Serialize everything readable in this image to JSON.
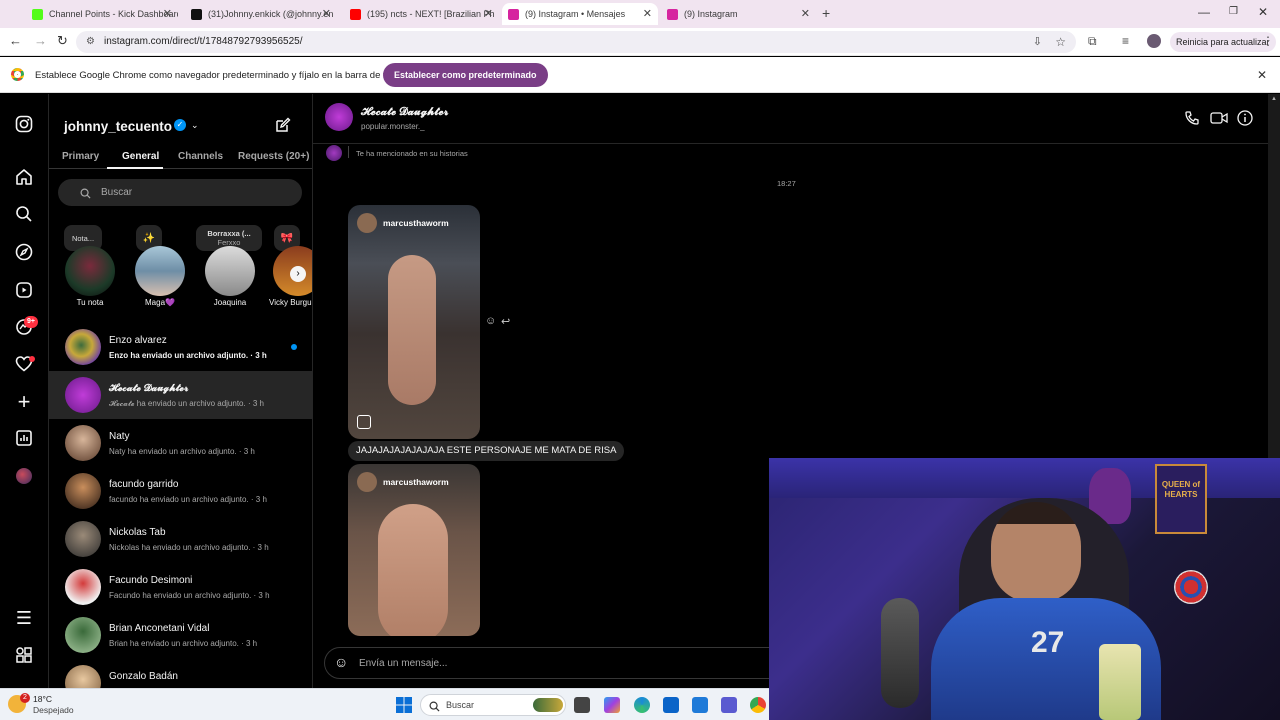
{
  "browser": {
    "tabs": [
      {
        "title": "Channel Points - Kick Dashboard",
        "color": "#53fc18"
      },
      {
        "title": "(31)Johnny.enkick (@johnny.en",
        "color": "#111111"
      },
      {
        "title": "(195) ncts - NEXT! [Brazilian Ph",
        "color": "#ff0000"
      },
      {
        "title": "(9) Instagram • Mensajes",
        "color": "#d6249f"
      },
      {
        "title": "(9) Instagram",
        "color": "#d6249f"
      }
    ],
    "url": "instagram.com/direct/t/17848792793956525/",
    "update_button": "Reinicia para actualizar",
    "infobar_text": "Establece Google Chrome como navegador predeterminado y fíjalo en la barra de tareas",
    "infobar_button": "Establecer como predeterminado",
    "accent": "#7a3e86"
  },
  "inbox": {
    "username": "johnny_tecuento",
    "tabs": [
      "Primary",
      "General",
      "Channels",
      "Requests (20+)"
    ],
    "active_tab": "General",
    "search_placeholder": "Buscar",
    "notes": [
      {
        "note": "Nota...",
        "name": "Tu nota"
      },
      {
        "note": "✨",
        "name": "Maga💜"
      },
      {
        "note": "Borraxxa (...",
        "sub": "Ferxxo",
        "name": "Joaquina"
      },
      {
        "note": "🎀",
        "name": "Vicky Burgu"
      }
    ],
    "conversations": [
      {
        "name": "Enzo alvarez",
        "preview": "Enzo ha enviado un archivo adjunto. · 3 h",
        "unread": true
      },
      {
        "name": "𝓗𝓮𝓬𝓪𝓽𝓮 𝓓𝓪𝓾𝓰𝓱𝓽𝓮𝓻",
        "preview": "𝓗𝓮𝓬𝓪𝓽𝓮 ha enviado un archivo adjunto. · 3 h",
        "selected": true
      },
      {
        "name": "Naty",
        "preview": "Naty ha enviado un archivo adjunto. · 3 h"
      },
      {
        "name": "facundo garrido",
        "preview": "facundo ha enviado un archivo adjunto. · 3 h"
      },
      {
        "name": "Nickolas Tab",
        "preview": "Nickolas ha enviado un archivo adjunto. · 3 h"
      },
      {
        "name": "Facundo Desimoni",
        "preview": "Facundo ha enviado un archivo adjunto. · 3 h"
      },
      {
        "name": "Brian Anconetani Vidal",
        "preview": "Brian ha enviado un archivo adjunto. · 3 h"
      },
      {
        "name": "Gonzalo Badán",
        "preview": ""
      }
    ],
    "nav_badge": "9+"
  },
  "chat": {
    "name": "𝓗𝓮𝓬𝓪𝓽𝓮 𝓓𝓪𝓾𝓰𝓱𝓽𝓮𝓻",
    "handle": "popular.monster._",
    "mention_text": "Te ha mencionado en su historias",
    "timestamp": "18:27",
    "reels": [
      {
        "author": "marcusthaworm"
      },
      {
        "author": "marcusthaworm"
      }
    ],
    "message": "JAJAJAJAJAJAJAJA ESTE PERSONAJE ME MATA DE RISA",
    "composer_placeholder": "Envía un mensaje..."
  },
  "taskbar": {
    "temp": "18°C",
    "weather": "Despejado",
    "search": "Buscar",
    "weather_badge": "2"
  },
  "webcam": {
    "jersey_number": "27",
    "poster_text": "QUEEN of HEARTS"
  }
}
